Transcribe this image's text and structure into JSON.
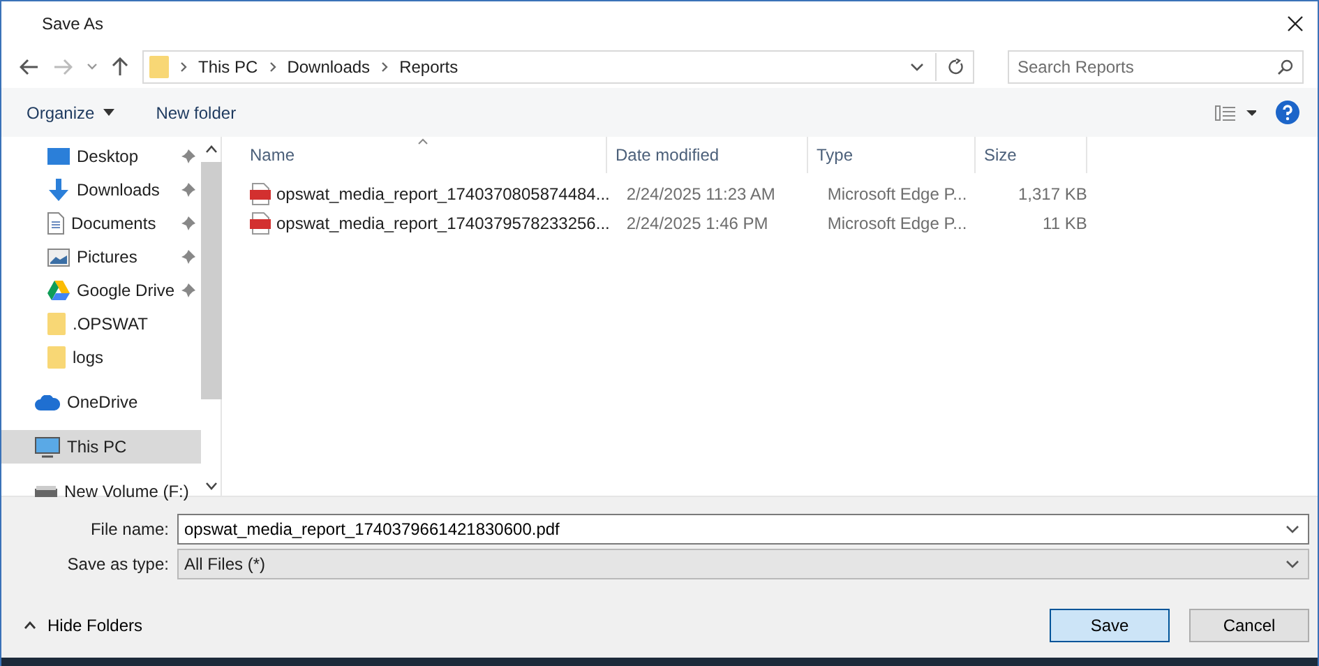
{
  "window": {
    "title": "Save As"
  },
  "breadcrumb": [
    "This PC",
    "Downloads",
    "Reports"
  ],
  "search": {
    "placeholder": "Search Reports"
  },
  "toolbar": {
    "organize": "Organize",
    "new_folder": "New folder"
  },
  "sidebar": {
    "items": [
      {
        "label": "Desktop",
        "kind": "desktop",
        "pinned": true,
        "selected": false
      },
      {
        "label": "Downloads",
        "kind": "download",
        "pinned": true,
        "selected": false
      },
      {
        "label": "Documents",
        "kind": "document",
        "pinned": true,
        "selected": false
      },
      {
        "label": "Pictures",
        "kind": "pictures",
        "pinned": true,
        "selected": false
      },
      {
        "label": "Google Drive",
        "kind": "drive",
        "pinned": true,
        "selected": false
      },
      {
        "label": ".OPSWAT",
        "kind": "folder",
        "pinned": false,
        "selected": false
      },
      {
        "label": "logs",
        "kind": "folder",
        "pinned": false,
        "selected": false
      },
      {
        "label": "OneDrive",
        "kind": "cloud",
        "pinned": false,
        "selected": false
      },
      {
        "label": "This PC",
        "kind": "pc",
        "pinned": false,
        "selected": true
      },
      {
        "label": "New Volume (F:)",
        "kind": "disk",
        "pinned": false,
        "selected": false
      }
    ]
  },
  "table": {
    "columns": [
      "Name",
      "Date modified",
      "Type",
      "Size"
    ],
    "rows": [
      [
        "opswat_media_report_1740370805874484...",
        "2/24/2025 11:23 AM",
        "Microsoft Edge P...",
        "1,317 KB"
      ],
      [
        "opswat_media_report_1740379578233256...",
        "2/24/2025 1:46 PM",
        "Microsoft Edge P...",
        "11 KB"
      ]
    ]
  },
  "file_name": {
    "label": "File name:",
    "value": "opswat_media_report_1740379661421830600.pdf"
  },
  "save_type": {
    "label": "Save as type:",
    "value": "All Files (*)"
  },
  "hide_folders": "Hide Folders",
  "buttons": [
    "Save",
    "Cancel"
  ]
}
